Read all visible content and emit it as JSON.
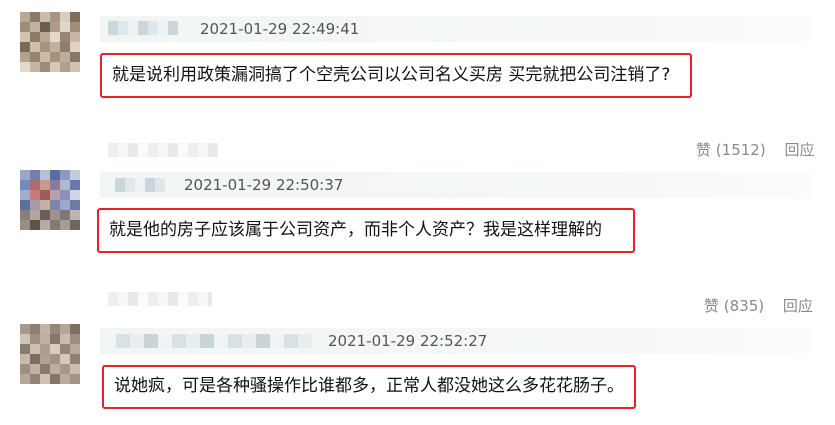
{
  "comments": [
    {
      "timestamp": "2021-01-29 22:49:41",
      "text": "就是说利用政策漏洞搞了个空壳公司以公司名义买房 买完就把公司注销了?",
      "like_label": "赞",
      "like_count": "(1512)",
      "reply_label": "回应",
      "colors": {
        "highlight_border": "#e8202a"
      }
    },
    {
      "timestamp": "2021-01-29 22:50:37",
      "text": "就是他的房子应该属于公司资产，而非个人资产？我是这样理解的",
      "like_label": "赞",
      "like_count": "(835)",
      "reply_label": "回应"
    },
    {
      "timestamp": "2021-01-29 22:52:27",
      "text": "说她疯，可是各种骚操作比谁都多，正常人都没她这么多花花肠子。"
    }
  ]
}
